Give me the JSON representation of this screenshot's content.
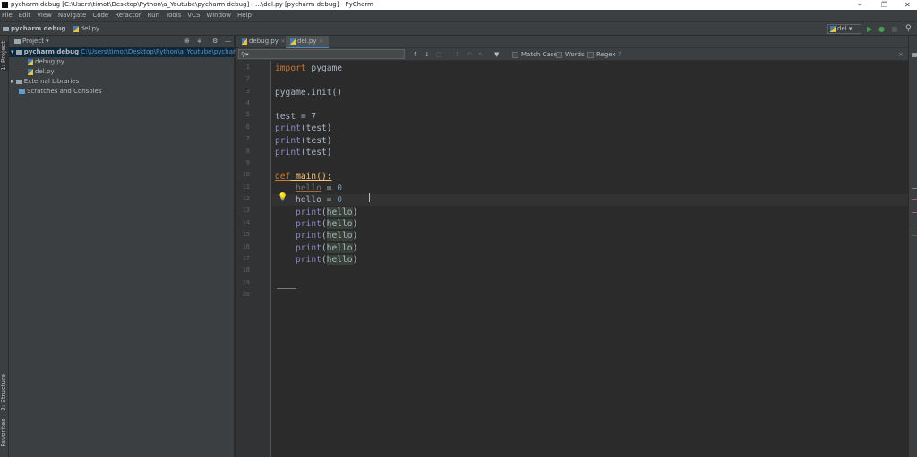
{
  "window": {
    "title": "pycharm debug [C:\\Users\\timot\\Desktop\\Python\\a_Youtube\\pycharm debug] - ...\\del.py [pycharm debug] - PyCharm",
    "minimize": "–",
    "restore": "❐",
    "close": "✕"
  },
  "menu": [
    "File",
    "Edit",
    "View",
    "Navigate",
    "Code",
    "Refactor",
    "Run",
    "Tools",
    "VCS",
    "Window",
    "Help"
  ],
  "breadcrumb": {
    "project": "pycharm debug",
    "file": "del.py"
  },
  "run_config": {
    "selected": "del"
  },
  "side_tabs": {
    "project": "1: Project",
    "structure": "2: Structure",
    "favorites": "Favorites"
  },
  "project_panel": {
    "title": "Project",
    "tree": [
      {
        "label": "pycharm debug",
        "path": "C:\\Users\\timot\\Desktop\\Python\\a_Youtube\\pycharm debug"
      },
      {
        "label": "debug.py"
      },
      {
        "label": "del.py"
      },
      {
        "label": "External Libraries"
      },
      {
        "label": "Scratches and Consoles"
      }
    ]
  },
  "editor_tabs": [
    {
      "label": "debug.py",
      "active": false
    },
    {
      "label": "del.py",
      "active": true
    }
  ],
  "find_bar": {
    "value": "",
    "options": [
      "Match Case",
      "Words",
      "Regex"
    ],
    "help": "?"
  },
  "code_lines": [
    "1",
    "2",
    "3",
    "4",
    "5",
    "6",
    "7",
    "8",
    "9",
    "10",
    "11",
    "12",
    "13",
    "14",
    "15",
    "16",
    "17",
    "18",
    "19",
    "20"
  ],
  "code": {
    "l1": [
      "import",
      " pygame"
    ],
    "l3": "pygame.init()",
    "l5": "test = 7",
    "print": "print",
    "test_arg": "(test)",
    "def": "def",
    "main": " main():",
    "hello": "hello",
    "eq0": " = ",
    "zero": "0",
    "hello_arg": "hello",
    "open": "(",
    "close": ")"
  },
  "colors": {
    "keyword": "#cc7832",
    "builtin": "#8888c6",
    "number": "#6897bb",
    "text": "#a9b7c6",
    "accent": "#4a88c7"
  }
}
